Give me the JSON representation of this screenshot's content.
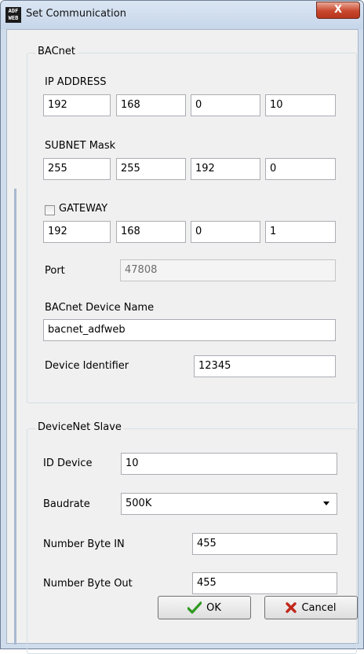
{
  "window": {
    "title": "Set Communication",
    "icon_text": "ADF WEB",
    "close_label": "X"
  },
  "bacnet": {
    "legend": "BACnet",
    "ip_label": "IP ADDRESS",
    "ip": [
      "192",
      "168",
      "0",
      "10"
    ],
    "subnet_label": "SUBNET Mask",
    "subnet": [
      "255",
      "255",
      "192",
      "0"
    ],
    "gateway_label": "GATEWAY",
    "gateway_checked": false,
    "gateway": [
      "192",
      "168",
      "0",
      "1"
    ],
    "port_label": "Port",
    "port": "47808",
    "device_name_label": "BACnet Device Name",
    "device_name": "bacnet_adfweb",
    "device_id_label": "Device Identifier",
    "device_id": "12345"
  },
  "devicenet": {
    "legend": "DeviceNet Slave",
    "id_label": "ID Device",
    "id": "10",
    "baudrate_label": "Baudrate",
    "baudrate": "500K",
    "byte_in_label": "Number Byte IN",
    "byte_in": "455",
    "byte_out_label": "Number Byte Out",
    "byte_out": "455"
  },
  "buttons": {
    "ok": "OK",
    "cancel": "Cancel"
  },
  "ip_separator": "."
}
